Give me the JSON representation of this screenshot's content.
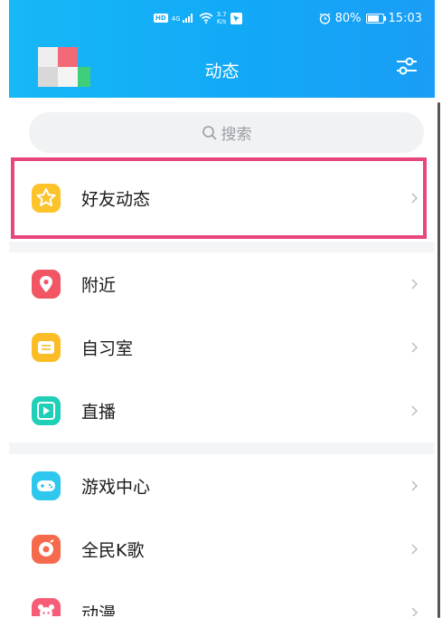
{
  "status_bar": {
    "hd_badge": "HD",
    "signal_label": "4G",
    "net_speed_value": "3.7",
    "net_speed_unit": "K/s",
    "battery_percent": "80%",
    "battery_level": 0.8,
    "time": "15:03"
  },
  "header": {
    "title": "动态"
  },
  "search": {
    "placeholder": "搜索"
  },
  "menu_groups": [
    [
      {
        "label": "好友动态",
        "icon": "star-icon",
        "color": "#fdc32b"
      }
    ],
    [
      {
        "label": "附近",
        "icon": "location-pin-icon",
        "color": "#f25564"
      },
      {
        "label": "自习室",
        "icon": "study-room-icon",
        "color": "#fbbd25"
      },
      {
        "label": "直播",
        "icon": "live-icon",
        "color": "#1fcfb7"
      }
    ],
    [
      {
        "label": "游戏中心",
        "icon": "gamepad-icon",
        "color": "#2ec8ef"
      },
      {
        "label": "全民K歌",
        "icon": "karaoke-icon",
        "color": "#f56a4c"
      },
      {
        "label": "动漫",
        "icon": "anime-icon",
        "color": "#f75d76"
      }
    ]
  ],
  "colors": {
    "header": "#15b0f7",
    "highlight": "#e8467e"
  }
}
